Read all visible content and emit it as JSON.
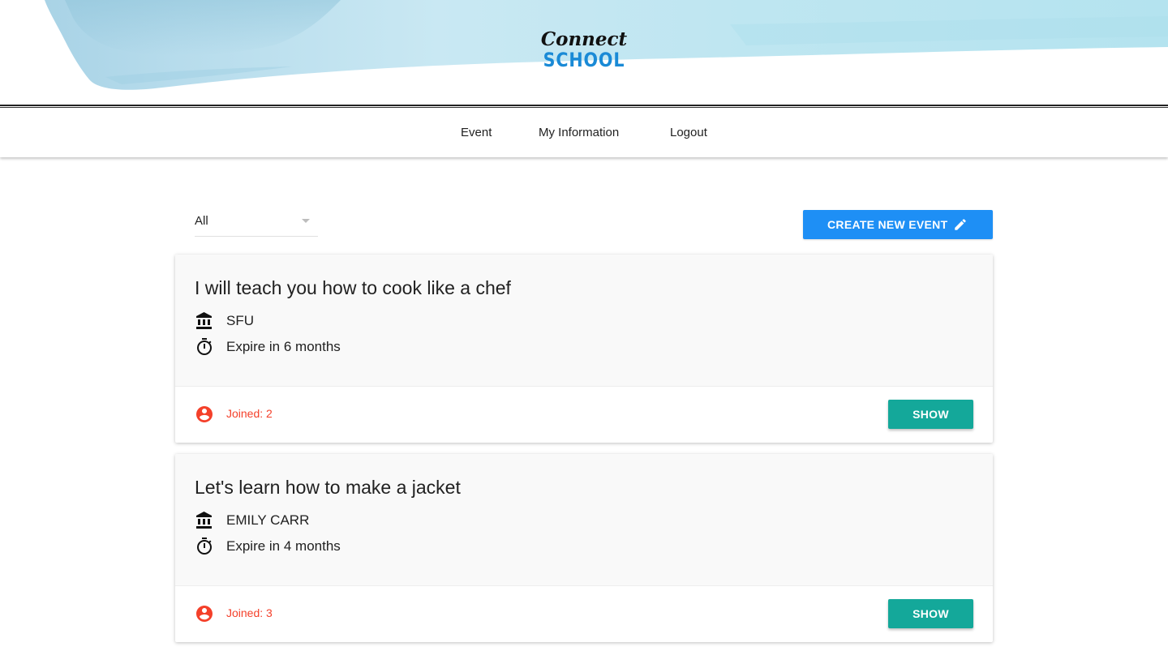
{
  "header": {
    "logo_top": "Connect",
    "logo_bottom": "SCHOOL",
    "accent_color": "#1a8ad6"
  },
  "nav": {
    "items": [
      {
        "label": "Event"
      },
      {
        "label": "My Information"
      },
      {
        "label": "Logout"
      }
    ]
  },
  "filter": {
    "selected": "All"
  },
  "create_button": {
    "label": "CREATE NEW EVENT",
    "icon": "pencil-icon",
    "color": "#1e8ff5"
  },
  "events": [
    {
      "title": "I will teach you how to cook like a chef",
      "school": "SFU",
      "school_icon": "institution-icon",
      "expire": "Expire in 6 months",
      "expire_icon": "timer-icon",
      "joined": "Joined: 2",
      "joined_icon": "account-circle-icon",
      "show_label": "SHOW"
    },
    {
      "title": "Let's learn how to make a jacket",
      "school": "EMILY CARR",
      "school_icon": "institution-icon",
      "expire": "Expire in 4 months",
      "expire_icon": "timer-icon",
      "joined": "Joined: 3",
      "joined_icon": "account-circle-icon",
      "show_label": "SHOW"
    }
  ],
  "colors": {
    "joined": "#f4402a",
    "show_button": "#14a89a"
  }
}
